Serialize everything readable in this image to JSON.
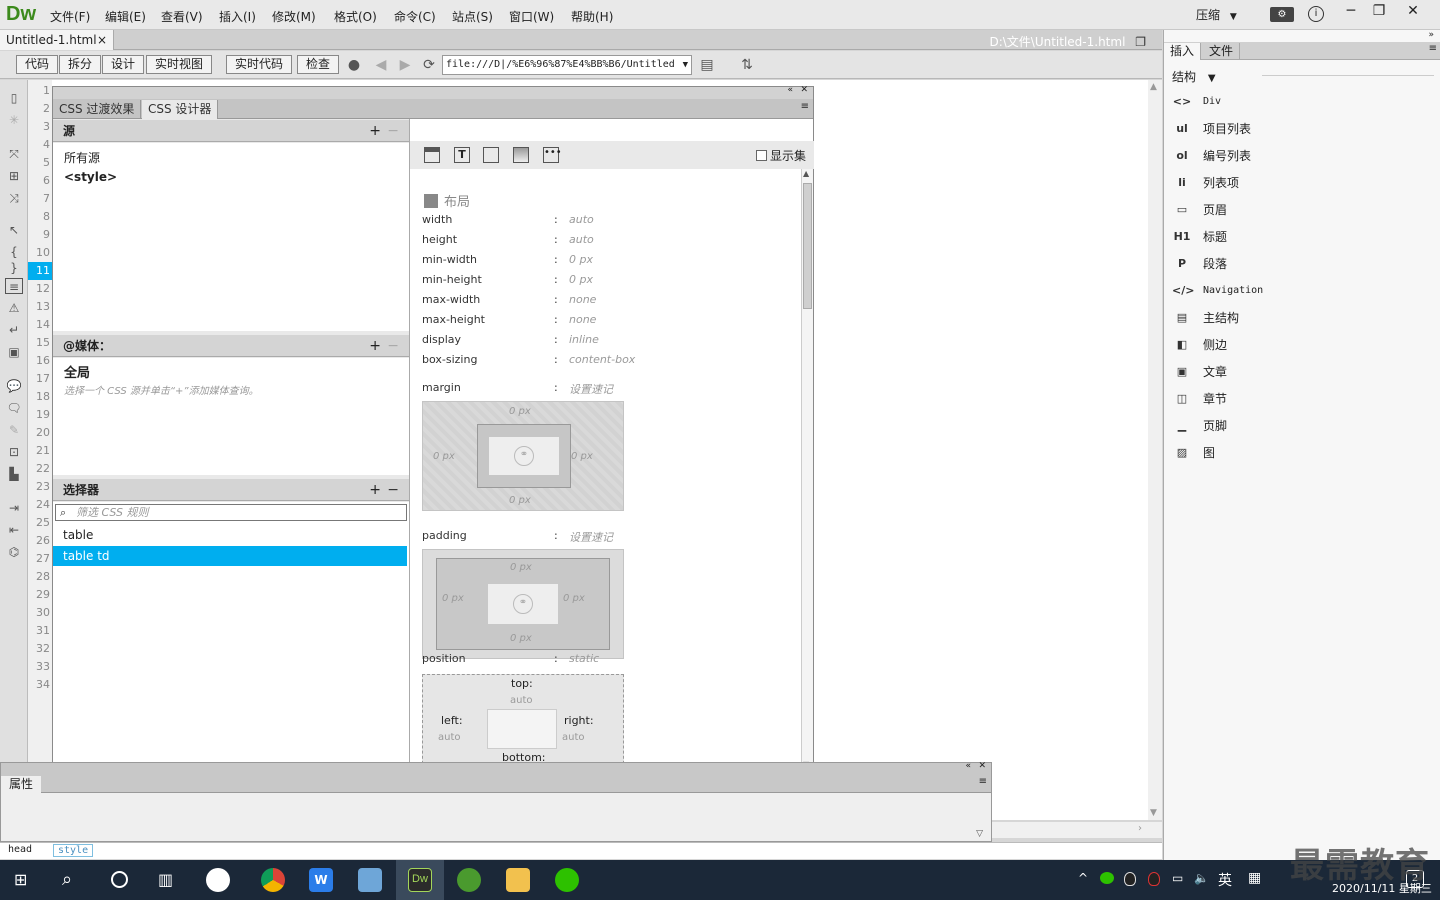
{
  "app": {
    "logo": "Dw"
  },
  "menu": [
    "文件(F)",
    "编辑(E)",
    "查看(V)",
    "插入(I)",
    "修改(M)",
    "格式(O)",
    "命令(C)",
    "站点(S)",
    "窗口(W)",
    "帮助(H)"
  ],
  "layout_dropdown": "压缩",
  "document": {
    "tab_name": "Untitled-1.html",
    "close": "×",
    "path": "D:\\文件\\Untitled-1.html"
  },
  "toolbar": {
    "code": "代码",
    "split": "拆分",
    "design": "设计",
    "live_view": "实时视图",
    "live_code": "实时代码",
    "inspect": "检查",
    "url": "file:///D|/%E6%96%87%E4%BB%B6/Untitled"
  },
  "line_numbers": [
    "1",
    "2",
    "3",
    "4",
    "5",
    "6",
    "7",
    "8",
    "9",
    "10",
    "11",
    "12",
    "13",
    "14",
    "15",
    "16",
    "17",
    "18",
    "19",
    "20",
    "21",
    "22",
    "23",
    "24",
    "25",
    "26",
    "27",
    "28",
    "29",
    "30",
    "31",
    "32",
    "33",
    "34"
  ],
  "active_line": "11",
  "css_designer": {
    "tabs": [
      "CSS 过渡效果",
      "CSS 设计器"
    ],
    "sources": {
      "title": "源",
      "items": [
        "所有源",
        "<style>"
      ]
    },
    "media": {
      "title": "@媒体：",
      "global": "全局",
      "hint": "选择一个 CSS 源并单击“+”添加媒体查询。"
    },
    "selectors": {
      "title": "选择器",
      "filter_placeholder": "筛选 CSS 规则",
      "items": [
        "table",
        "table td"
      ]
    },
    "properties": {
      "title": "属性",
      "show_set": "显示集",
      "layout_label": "布局",
      "rows": [
        {
          "name": "width",
          "value": "auto"
        },
        {
          "name": "height",
          "value": "auto"
        },
        {
          "name": "min-width",
          "value": "0 px"
        },
        {
          "name": "min-height",
          "value": "0 px"
        },
        {
          "name": "max-width",
          "value": "none"
        },
        {
          "name": "max-height",
          "value": "none"
        },
        {
          "name": "display",
          "value": "inline"
        },
        {
          "name": "box-sizing",
          "value": "content-box"
        }
      ],
      "margin": {
        "name": "margin",
        "shorthand": "设置速记",
        "top": "0 px",
        "left": "0 px",
        "right": "0 px",
        "bottom": "0 px"
      },
      "padding": {
        "name": "padding",
        "shorthand": "设置速记",
        "top": "0 px",
        "left": "0 px",
        "right": "0 px",
        "bottom": "0 px"
      },
      "position": {
        "name": "position",
        "value": "static"
      },
      "offsets": {
        "top": "top:",
        "top_val": "auto",
        "left": "left:",
        "left_val": "auto",
        "right": "right:",
        "right_val": "auto",
        "bottom": "bottom:"
      }
    }
  },
  "properties_panel": {
    "title": "属性"
  },
  "status_tags": [
    "head",
    "style"
  ],
  "insert_panel": {
    "tabs": [
      "插入",
      "文件"
    ],
    "category": "结构",
    "items": [
      {
        "icon": "<>",
        "label": "Div"
      },
      {
        "icon": "ul",
        "label": "项目列表"
      },
      {
        "icon": "ol",
        "label": "编号列表"
      },
      {
        "icon": "li",
        "label": "列表项"
      },
      {
        "icon": "▭",
        "label": "页眉"
      },
      {
        "icon": "H1",
        "label": "标题"
      },
      {
        "icon": "P",
        "label": "段落"
      },
      {
        "icon": "</>",
        "label": "Navigation"
      },
      {
        "icon": "▤",
        "label": "主结构"
      },
      {
        "icon": "◧",
        "label": "侧边"
      },
      {
        "icon": "▣",
        "label": "文章"
      },
      {
        "icon": "◫",
        "label": "章节"
      },
      {
        "icon": "▁",
        "label": "页脚"
      },
      {
        "icon": "▨",
        "label": "图"
      }
    ]
  },
  "taskbar": {
    "ime": "英",
    "date": "2020/11/11 星期三",
    "notifications": "2"
  },
  "watermark": "最需教育"
}
